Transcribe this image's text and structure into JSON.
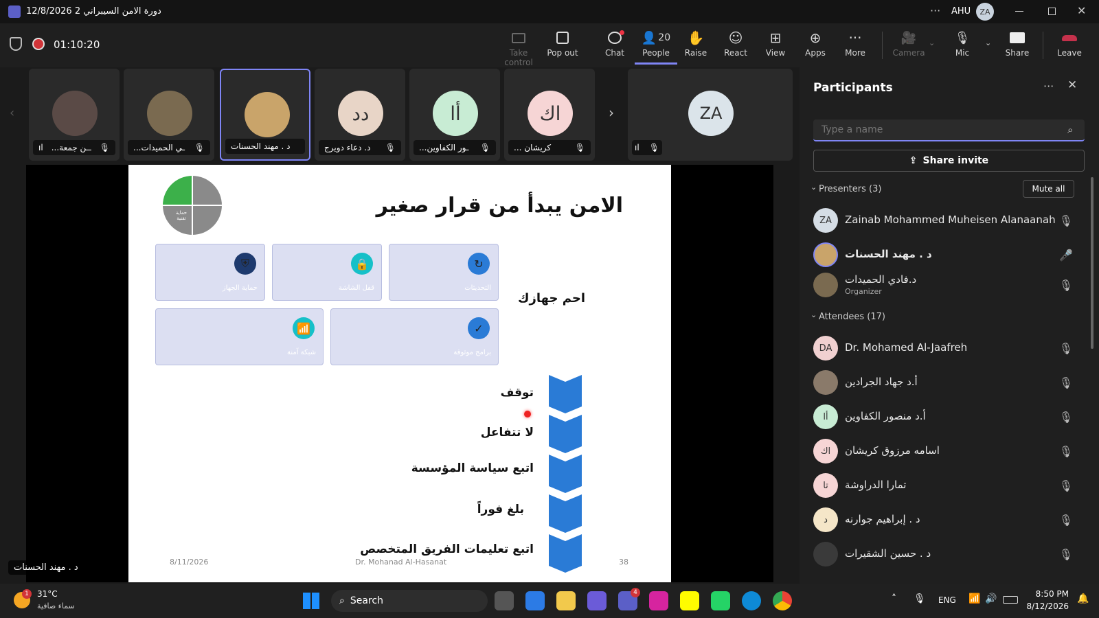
{
  "window": {
    "title": "دورة الامن السيبراني 2 12/8/2026",
    "org": "AHU",
    "user_initials": "ZA"
  },
  "meeting": {
    "timer": "01:10:20"
  },
  "toolbar": {
    "take_control": "Take control",
    "pop_out": "Pop out",
    "chat": "Chat",
    "people": "People",
    "people_count": "20",
    "raise": "Raise",
    "react": "React",
    "view": "View",
    "apps": "Apps",
    "more": "More",
    "camera": "Camera",
    "mic": "Mic",
    "share": "Share",
    "leave": "Leave"
  },
  "strip": {
    "tiles": [
      {
        "name": "...ــن جمعة",
        "initials": ""
      },
      {
        "name": "...ـي الحميدات",
        "initials": ""
      },
      {
        "name": "د . مهند الحسنات",
        "initials": ""
      },
      {
        "name": "د. دعاء دويرج",
        "initials": "دد"
      },
      {
        "name": "...ـور الكفاوين",
        "initials": "أا"
      },
      {
        "name": "... كريشان",
        "initials": "اك"
      },
      {
        "name": "",
        "initials": "ZA"
      }
    ]
  },
  "slide": {
    "title": "الامن يبدأ من قرار صغير",
    "subtitle": "احم جهازك",
    "logo_text": "حماية تقنية",
    "cards": [
      {
        "label": "التحديثات",
        "icon": "refresh-icon"
      },
      {
        "label": "قفل الشاشة",
        "icon": "lock-icon"
      },
      {
        "label": "حماية الجهاز",
        "icon": "shield-icon"
      },
      {
        "label": "برامج موثوقة",
        "icon": "check-icon"
      },
      {
        "label": "شبكة آمنة",
        "icon": "wifi-icon"
      }
    ],
    "steps": [
      "توقف",
      "لا تتفاعل",
      "اتبع سياسة المؤسسة",
      "بلغ فوراً",
      "اتبع تعليمات الفريق المتخصص"
    ],
    "footer_date": "8/11/2026",
    "footer_author": "Dr. Mohanad Al-Hasanat",
    "footer_page": "38"
  },
  "presenter_label": "د . مهند الحسنات",
  "participants": {
    "title": "Participants",
    "search_placeholder": "Type a name",
    "share_invite": "Share invite",
    "presenters_header": "Presenters (3)",
    "mute_all": "Mute all",
    "presenters": [
      {
        "name": "Zainab Mohammed Muheisen Alanaanah",
        "initials": "ZA",
        "sub": ""
      },
      {
        "name": "د . مهند الحسنات",
        "initials": "",
        "sub": ""
      },
      {
        "name": "د.فادي الحميدات",
        "initials": "",
        "sub": "Organizer"
      }
    ],
    "attendees_header": "Attendees (17)",
    "attendees": [
      {
        "name": "Dr. Mohamed Al-Jaafreh",
        "initials": "DA"
      },
      {
        "name": "أ.د جهاد الجرادين",
        "initials": ""
      },
      {
        "name": "أ.د منصور الكفاوين",
        "initials": "أا"
      },
      {
        "name": "اسامه مرزوق كريشان",
        "initials": "اك"
      },
      {
        "name": "تمارا الدراوشة",
        "initials": "تا"
      },
      {
        "name": "د . إبراهيم جوارنه",
        "initials": "د"
      },
      {
        "name": "د . حسين الشقيرات",
        "initials": ""
      }
    ]
  },
  "taskbar": {
    "weather_temp": "31°C",
    "weather_desc": "سماء صافية",
    "weather_badge": "1",
    "search": "Search",
    "teams_badge": "4",
    "lang": "ENG",
    "time": "8:50 PM",
    "date": "8/12/2026"
  },
  "colors": {
    "accent": "#7f85f5",
    "leave": "#c4314b",
    "slide_blue": "#2a7bd6",
    "card_bg": "#dcdff2"
  }
}
